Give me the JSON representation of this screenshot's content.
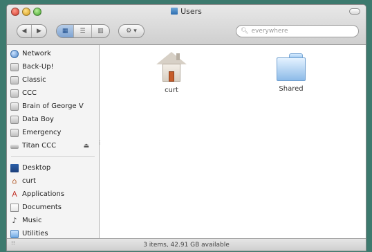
{
  "window": {
    "title": "Users",
    "search_placeholder": "everywhere",
    "status": "3 items, 42.91 GB available"
  },
  "toolbar": {
    "back_icon": "back-arrow-icon",
    "forward_icon": "forward-arrow-icon",
    "view_icons": [
      "icon-view-icon",
      "list-view-icon",
      "column-view-icon"
    ],
    "action_icon": "gear-icon"
  },
  "sidebar": {
    "devices": [
      {
        "label": "Network",
        "icon": "network-globe-icon"
      },
      {
        "label": "Back-Up!",
        "icon": "hard-disk-icon"
      },
      {
        "label": "Classic",
        "icon": "hard-disk-icon"
      },
      {
        "label": "CCC",
        "icon": "hard-disk-icon"
      },
      {
        "label": "Brain of George V",
        "icon": "hard-disk-icon"
      },
      {
        "label": "Data Boy",
        "icon": "hard-disk-icon"
      },
      {
        "label": "Emergency",
        "icon": "hard-disk-icon"
      },
      {
        "label": "Titan CCC",
        "icon": "network-disk-icon",
        "eject": "⏏"
      }
    ],
    "places": [
      {
        "label": "Desktop",
        "icon": "desktop-icon"
      },
      {
        "label": "curt",
        "icon": "home-icon"
      },
      {
        "label": "Applications",
        "icon": "applications-icon"
      },
      {
        "label": "Documents",
        "icon": "documents-icon"
      },
      {
        "label": "Music",
        "icon": "music-icon"
      },
      {
        "label": "Utilities",
        "icon": "utilities-folder-icon"
      }
    ]
  },
  "files": [
    {
      "name": "curt",
      "icon": "home-house-icon"
    },
    {
      "name": "Shared",
      "icon": "folder-icon"
    }
  ]
}
